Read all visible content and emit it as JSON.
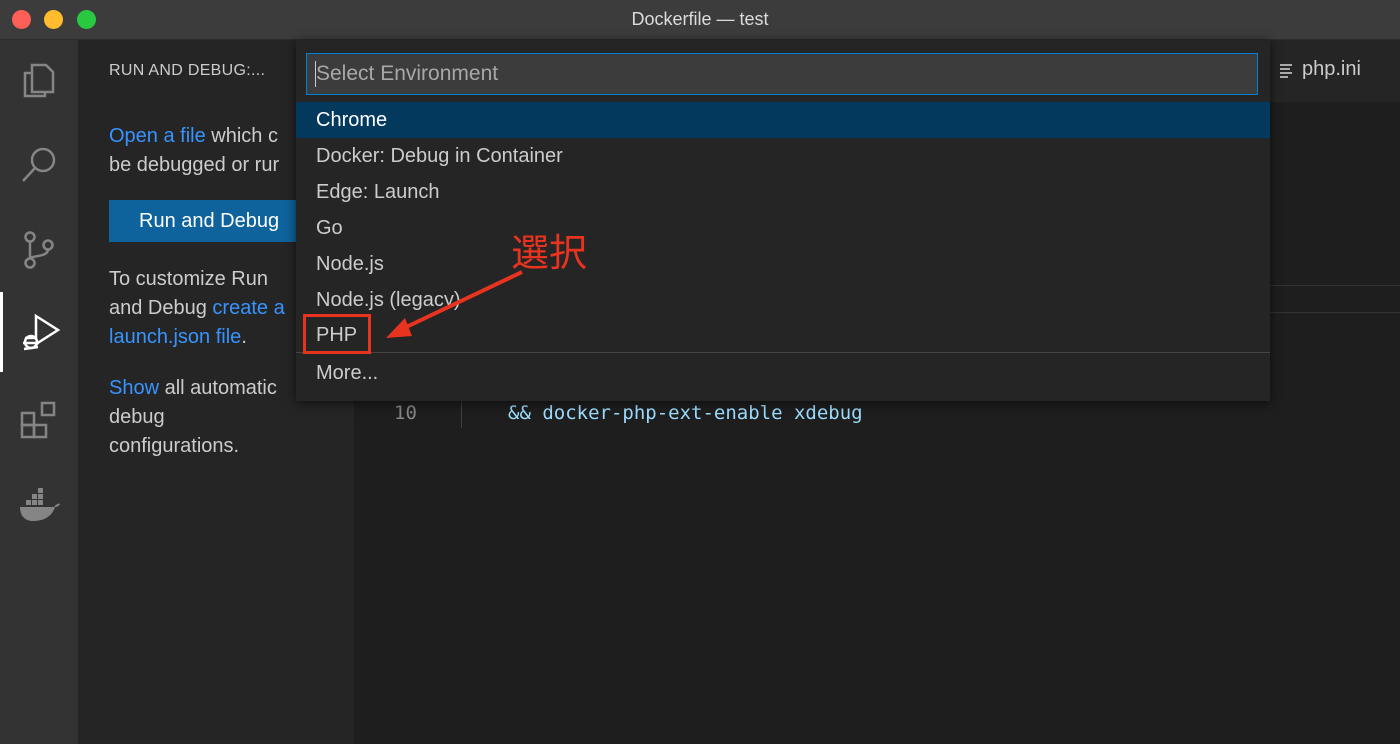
{
  "window": {
    "title": "Dockerfile — test"
  },
  "activity_bar": {
    "items": [
      {
        "name": "explorer-icon"
      },
      {
        "name": "search-icon"
      },
      {
        "name": "source-control-icon"
      },
      {
        "name": "run-debug-icon",
        "active": true
      },
      {
        "name": "extensions-icon"
      },
      {
        "name": "docker-icon"
      }
    ]
  },
  "sidebar": {
    "title": "RUN AND DEBUG:...",
    "open_link": "Open a file",
    "open_text_line1_rest": " which c",
    "open_text_line2": "be debugged or rur",
    "run_button": "Run and Debug",
    "customize_line1": "To customize Run",
    "customize_line2_prefix": "and Debug ",
    "customize_line2_link": "create a",
    "customize_line3_link": "launch.json file",
    "customize_line3_suffix": ".",
    "show_link": "Show",
    "show_line1_rest": " all automatic",
    "show_line2": "debug",
    "show_line3": "configurations."
  },
  "editor": {
    "tab": "php.ini",
    "line_number": "10",
    "code_line": "&& docker-php-ext-enable xdebug"
  },
  "quick_pick": {
    "placeholder": "Select Environment",
    "items": [
      {
        "label": "Chrome",
        "selected": true
      },
      {
        "label": "Docker: Debug in Container"
      },
      {
        "label": "Edge: Launch"
      },
      {
        "label": "Go"
      },
      {
        "label": "Node.js"
      },
      {
        "label": "Node.js (legacy)"
      },
      {
        "label": "PHP"
      },
      {
        "label": "More..."
      }
    ]
  },
  "annotation": {
    "label": "選択",
    "color": "#e8331f"
  },
  "colors": {
    "accent": "#007fd4",
    "button": "#0e639c",
    "link": "#3794ff",
    "selection": "#04395e"
  }
}
